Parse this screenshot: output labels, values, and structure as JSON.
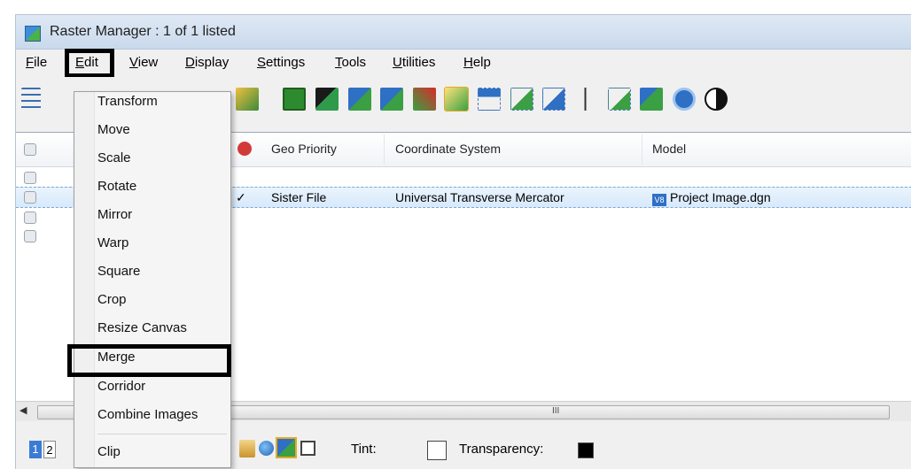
{
  "window": {
    "title": "Raster Manager : 1 of 1 listed"
  },
  "menubar": {
    "items": [
      {
        "label": "File",
        "u": "F",
        "rest": "ile"
      },
      {
        "label": "Edit",
        "u": "E",
        "rest": "dit"
      },
      {
        "label": "View",
        "u": "V",
        "rest": "iew"
      },
      {
        "label": "Display",
        "u": "D",
        "rest": "isplay"
      },
      {
        "label": "Settings",
        "u": "S",
        "rest": "ettings"
      },
      {
        "label": "Tools",
        "u": "T",
        "rest": "ools"
      },
      {
        "label": "Utilities",
        "u": "U",
        "rest": "tilities"
      },
      {
        "label": "Help",
        "u": "H",
        "rest": "elp"
      }
    ]
  },
  "list": {
    "columns": {
      "geo_priority": "Geo Priority",
      "coordinate_system": "Coordinate System",
      "model": "Model"
    },
    "row": {
      "check": "✓",
      "geo_priority": "Sister File",
      "coordinate_system": "Universal Transverse Mercator",
      "model": "Project Image.dgn"
    }
  },
  "scrollbar": {
    "grip": "III"
  },
  "status": {
    "page1": "1",
    "page2": "2",
    "tint_label": "Tint:",
    "transparency_label": "Transparency:"
  },
  "edit_menu": {
    "items": [
      "Transform",
      "Move",
      "Scale",
      "Rotate",
      "Mirror",
      "Warp",
      "Square",
      "Crop",
      "Resize Canvas",
      "Merge",
      "Corridor",
      "Combine Images",
      "Clip"
    ]
  },
  "colors": {
    "accent": "#3b7bd6",
    "highlight_box": "#000000",
    "selected_row": "#d7e9fb"
  }
}
